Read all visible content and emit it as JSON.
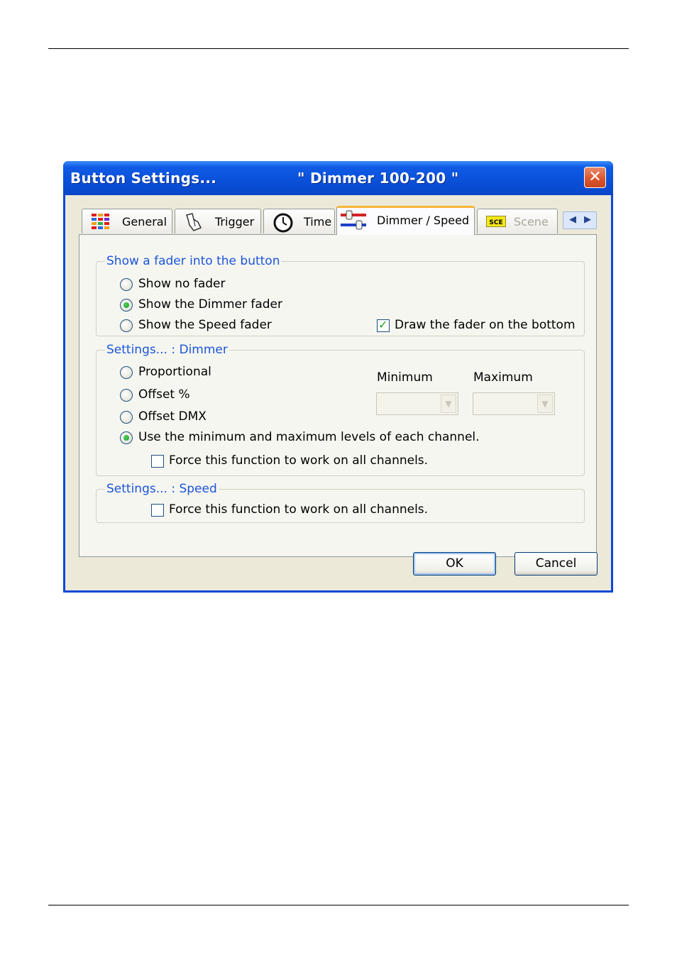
{
  "dialog": {
    "title": "Button  Settings...",
    "subtitle": "\" Dimmer 100-200 \"",
    "close_glyph": "✕"
  },
  "tabs": [
    {
      "label": "General",
      "icon": "color-grid-icon",
      "active": false
    },
    {
      "label": "Trigger",
      "icon": "hand-pointer-icon",
      "active": false
    },
    {
      "label": "Time",
      "icon": "clock-icon",
      "active": false
    },
    {
      "label": "Dimmer / Speed",
      "icon": "sliders-icon",
      "active": true
    },
    {
      "label": "Scene",
      "icon": "sce-badge-icon",
      "active": false,
      "disabled": true
    }
  ],
  "tab_scroll": {
    "left": "◀",
    "right": "▶"
  },
  "fader_group": {
    "title": "Show a fader into the button",
    "options": [
      {
        "label": "Show no fader",
        "selected": false
      },
      {
        "label": "Show the Dimmer fader",
        "selected": true
      },
      {
        "label": "Show the Speed fader",
        "selected": false
      }
    ],
    "draw_bottom": {
      "label": "Draw the fader on the bottom",
      "checked": true
    }
  },
  "dimmer_group": {
    "title": "Settings... : Dimmer",
    "options": [
      {
        "label": "Proportional",
        "selected": false
      },
      {
        "label": "Offset %",
        "selected": false
      },
      {
        "label": "Offset DMX",
        "selected": false
      },
      {
        "label": "Use the minimum and maximum levels of each channel.",
        "selected": true
      }
    ],
    "force_all": {
      "label": "Force this function to work on all channels.",
      "checked": false
    },
    "minimum_label": "Minimum",
    "maximum_label": "Maximum",
    "minimum_value": "",
    "maximum_value": ""
  },
  "speed_group": {
    "title": "Settings... : Speed",
    "force_all": {
      "label": "Force this function to work on all channels.",
      "checked": false
    }
  },
  "buttons": {
    "ok": "OK",
    "cancel": "Cancel"
  },
  "colors": {
    "title_bar": "#0a4fd8",
    "group_title": "#1a55d8",
    "dialog_bg": "#ece9d8",
    "active_tab_accent": "#f7b53a"
  }
}
